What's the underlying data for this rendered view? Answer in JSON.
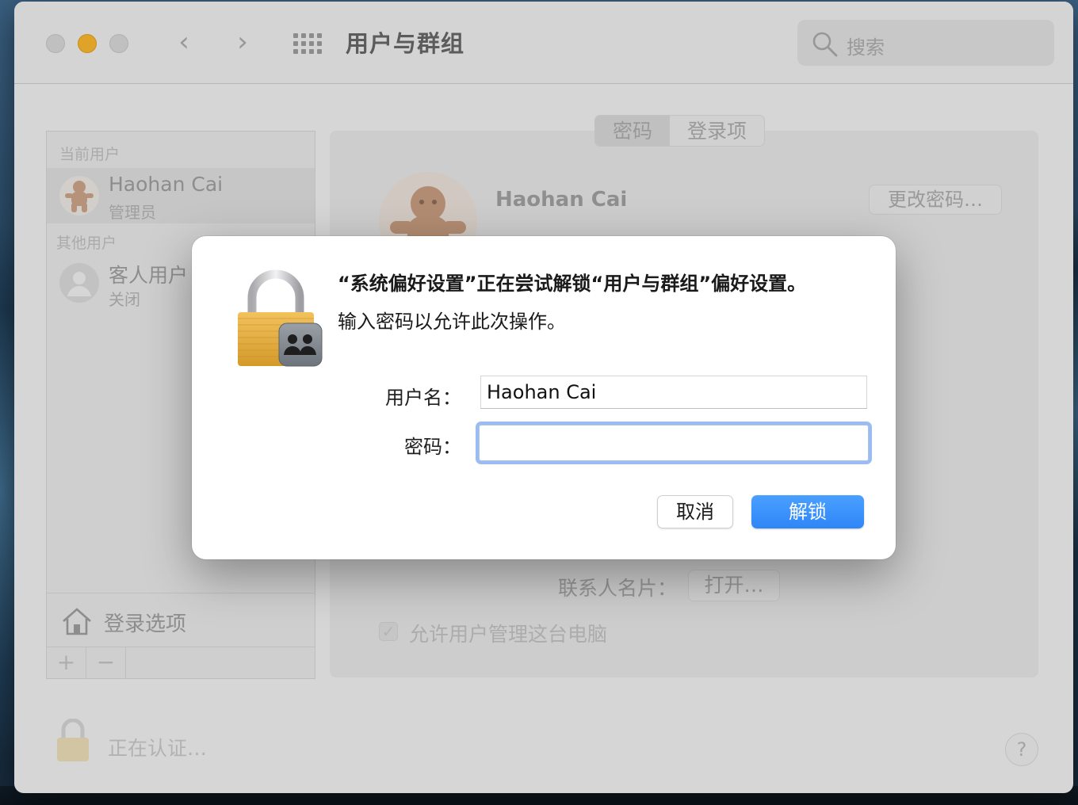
{
  "window": {
    "title": "用户与群组",
    "search_placeholder": "搜索",
    "nav_back": "‹",
    "nav_forward": "›"
  },
  "sidebar": {
    "current_users_header": "当前用户",
    "current_user": {
      "name": "Haohan Cai",
      "role": "管理员"
    },
    "other_users_header": "其他用户",
    "guest_user": {
      "name": "客人用户",
      "status": "关闭"
    },
    "login_options_label": "登录选项",
    "add_label": "+",
    "remove_label": "−"
  },
  "pane": {
    "tabs": [
      {
        "label": "密码",
        "selected": true
      },
      {
        "label": "登录项",
        "selected": false
      }
    ],
    "user_name": "Haohan Cai",
    "change_password_label": "更改密码…",
    "contact_card_label": "联系人名片：",
    "open_label": "打开…",
    "allow_admin_label": "允许用户管理这台电脑",
    "allow_admin_checked": true
  },
  "footer": {
    "auth_status": "正在认证…",
    "help_label": "?"
  },
  "dialog": {
    "title": "“系统偏好设置”正在尝试解锁“用户与群组”偏好设置。",
    "message": "输入密码以允许此次操作。",
    "username_label": "用户名：",
    "username_value": "Haohan Cai",
    "password_label": "密码：",
    "password_value": "",
    "cancel_label": "取消",
    "unlock_label": "解锁"
  },
  "colors": {
    "accent": "#2f86f7",
    "traffic_minimize": "#f5b42c"
  }
}
